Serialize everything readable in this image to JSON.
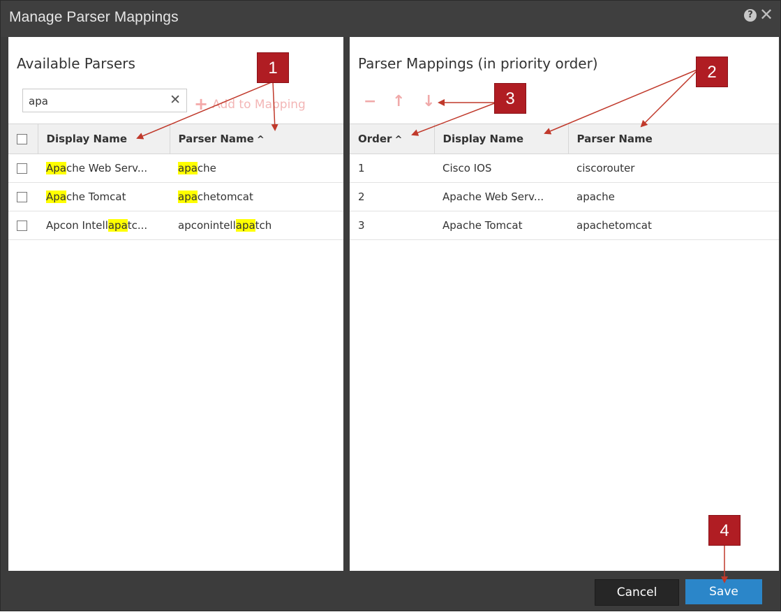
{
  "dialog": {
    "title": "Manage Parser Mappings",
    "help_icon": "?",
    "close_icon": "✕"
  },
  "left": {
    "title": "Available Parsers",
    "search": {
      "value": "apa",
      "clear_icon": "✕"
    },
    "add_label": "Add to Mapping",
    "columns": [
      "Display Name",
      "Parser Name"
    ],
    "rows": [
      {
        "display": [
          "",
          "Apa",
          "che Web Serv..."
        ],
        "parser": [
          "",
          "apa",
          "che"
        ]
      },
      {
        "display": [
          "",
          "Apa",
          "che Tomcat"
        ],
        "parser": [
          "",
          "apa",
          "chetomcat"
        ]
      },
      {
        "display": [
          "Apcon Intell",
          "apa",
          "tc..."
        ],
        "parser": [
          "apconintell",
          "apa",
          "tch"
        ]
      }
    ]
  },
  "right": {
    "title": "Parser Mappings (in priority order)",
    "columns": [
      "Order",
      "Display Name",
      "Parser Name"
    ],
    "rows": [
      {
        "order": "1",
        "display": "Cisco IOS",
        "parser": "ciscorouter"
      },
      {
        "order": "2",
        "display": "Apache Web Serv...",
        "parser": "apache"
      },
      {
        "order": "3",
        "display": "Apache Tomcat",
        "parser": "apachetomcat"
      }
    ]
  },
  "footer": {
    "cancel": "Cancel",
    "save": "Save"
  },
  "callouts": [
    "1",
    "2",
    "3",
    "4"
  ],
  "colors": {
    "callout": "#b01d23",
    "highlight": "#ffff00",
    "save": "#2b86c9",
    "toolbar_icon": "#f0a9a9"
  }
}
